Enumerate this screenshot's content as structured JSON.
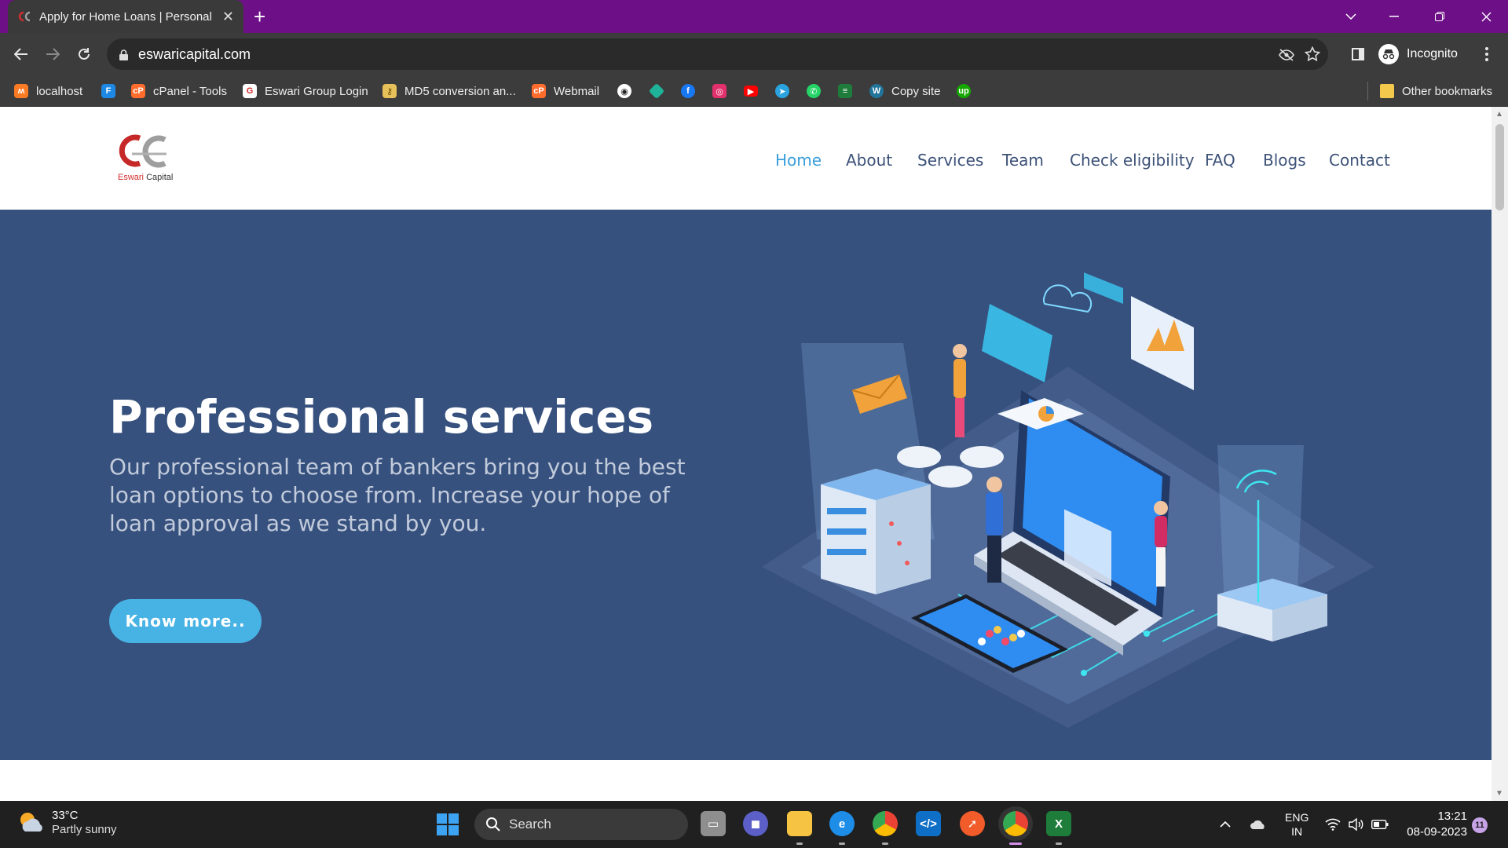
{
  "browser": {
    "tab_title": "Apply for Home Loans | Personal",
    "tab_close": "✕",
    "new_tab": "+",
    "url": "eswaricapital.com",
    "profile_label": "Incognito"
  },
  "bookmarks": [
    {
      "label": "localhost",
      "icon": "xampp-icon",
      "color": "#fb7a24"
    },
    {
      "label": "",
      "icon": "f-icon",
      "color": "#1e88e5"
    },
    {
      "label": "cPanel - Tools",
      "icon": "cpanel-icon",
      "color": "#ff6c2c"
    },
    {
      "label": "Eswari Group Login",
      "icon": "eswari-icon",
      "color": "#ffffff"
    },
    {
      "label": "MD5 conversion an...",
      "icon": "key-icon",
      "color": "#e6c15a"
    },
    {
      "label": "Webmail",
      "icon": "cpanel-icon",
      "color": "#ff6c2c"
    },
    {
      "label": "",
      "icon": "github-icon",
      "color": "#ffffff"
    },
    {
      "label": "",
      "icon": "diamond-icon",
      "color": "#1fb39a"
    },
    {
      "label": "",
      "icon": "facebook-icon",
      "color": "#1877f2"
    },
    {
      "label": "",
      "icon": "instagram-icon",
      "color": "#e1306c"
    },
    {
      "label": "",
      "icon": "youtube-icon",
      "color": "#ff0000"
    },
    {
      "label": "",
      "icon": "telegram-icon",
      "color": "#2aa3e0"
    },
    {
      "label": "",
      "icon": "whatsapp-icon",
      "color": "#25d366"
    },
    {
      "label": "",
      "icon": "sheet-icon",
      "color": "#1e7d3a"
    },
    {
      "label": "Copy site",
      "icon": "w-icon",
      "color": "#21759b"
    },
    {
      "label": "",
      "icon": "upwork-icon",
      "color": "#14a800"
    }
  ],
  "other_bookmarks": "Other bookmarks",
  "site": {
    "logo_text_prefix": "Eswari",
    "logo_text_suffix": " Capital",
    "nav": [
      "Home",
      "About",
      "Services",
      "Team",
      "Check eligibility",
      "FAQ",
      "Blogs",
      "Contact"
    ],
    "active_nav": "Home",
    "hero_title": "Professional services",
    "hero_text": "Our professional team of bankers bring you the best loan options to choose from. Increase your hope of loan approval as we stand by you.",
    "cta": "Know more..",
    "colors": {
      "hero_bg": "#37517e",
      "accent": "#47b2e4",
      "nav": "#3d5278"
    }
  },
  "taskbar": {
    "temperature": "33°C",
    "weather": "Partly sunny",
    "search": "Search",
    "lang_top": "ENG",
    "lang_bottom": "IN",
    "time": "13:21",
    "date": "08-09-2023",
    "notifications": "11"
  }
}
